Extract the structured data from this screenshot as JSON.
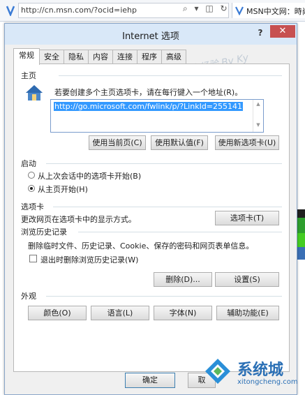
{
  "browser": {
    "url": "http://cn.msn.com/?ocid=iehp",
    "tab_title": "MSN中文网：時尚",
    "toolbar_icons": "⌕ ▾ ◫ ↻"
  },
  "dialog": {
    "title": "Internet 选项",
    "help": "?",
    "close": "✕"
  },
  "tabs": [
    "常规",
    "安全",
    "隐私",
    "内容",
    "连接",
    "程序",
    "高级"
  ],
  "homepage": {
    "heading": "主页",
    "instruction": "若要创建多个主页选项卡，请在每行键入一个地址(R)。",
    "url_value": "http://go.microsoft.com/fwlink/p/?LinkId=255141",
    "buttons": [
      "使用当前页(C)",
      "使用默认值(F)",
      "使用新选项卡(U)"
    ]
  },
  "startup": {
    "heading": "启动",
    "options": [
      "从上次会话中的选项卡开始(B)",
      "从主页开始(H)"
    ],
    "selected_index": 1
  },
  "tabs_section": {
    "heading": "选项卡",
    "description": "更改网页在选项卡中的显示方式。",
    "button": "选项卡(T)"
  },
  "history": {
    "heading": "浏览历史记录",
    "description": "删除临时文件、历史记录、Cookie、保存的密码和网页表单信息。",
    "checkbox_label": "退出时删除浏览历史记录(W)",
    "checkbox_checked": false,
    "buttons": [
      "删除(D)...",
      "设置(S)"
    ]
  },
  "appearance": {
    "heading": "外观",
    "buttons": [
      "颜色(O)",
      "语言(L)",
      "字体(N)",
      "辅助功能(E)"
    ]
  },
  "footer": {
    "ok": "确定",
    "cancel_partial": "取"
  },
  "watermark": {
    "text": "百度经验 By Ky",
    "brand": "系统城",
    "brand_url": "xitongcheng.com"
  },
  "colors": {
    "accent": "#3399ff",
    "close_red": "#c75050",
    "titlebar": "#d9e8f8"
  }
}
